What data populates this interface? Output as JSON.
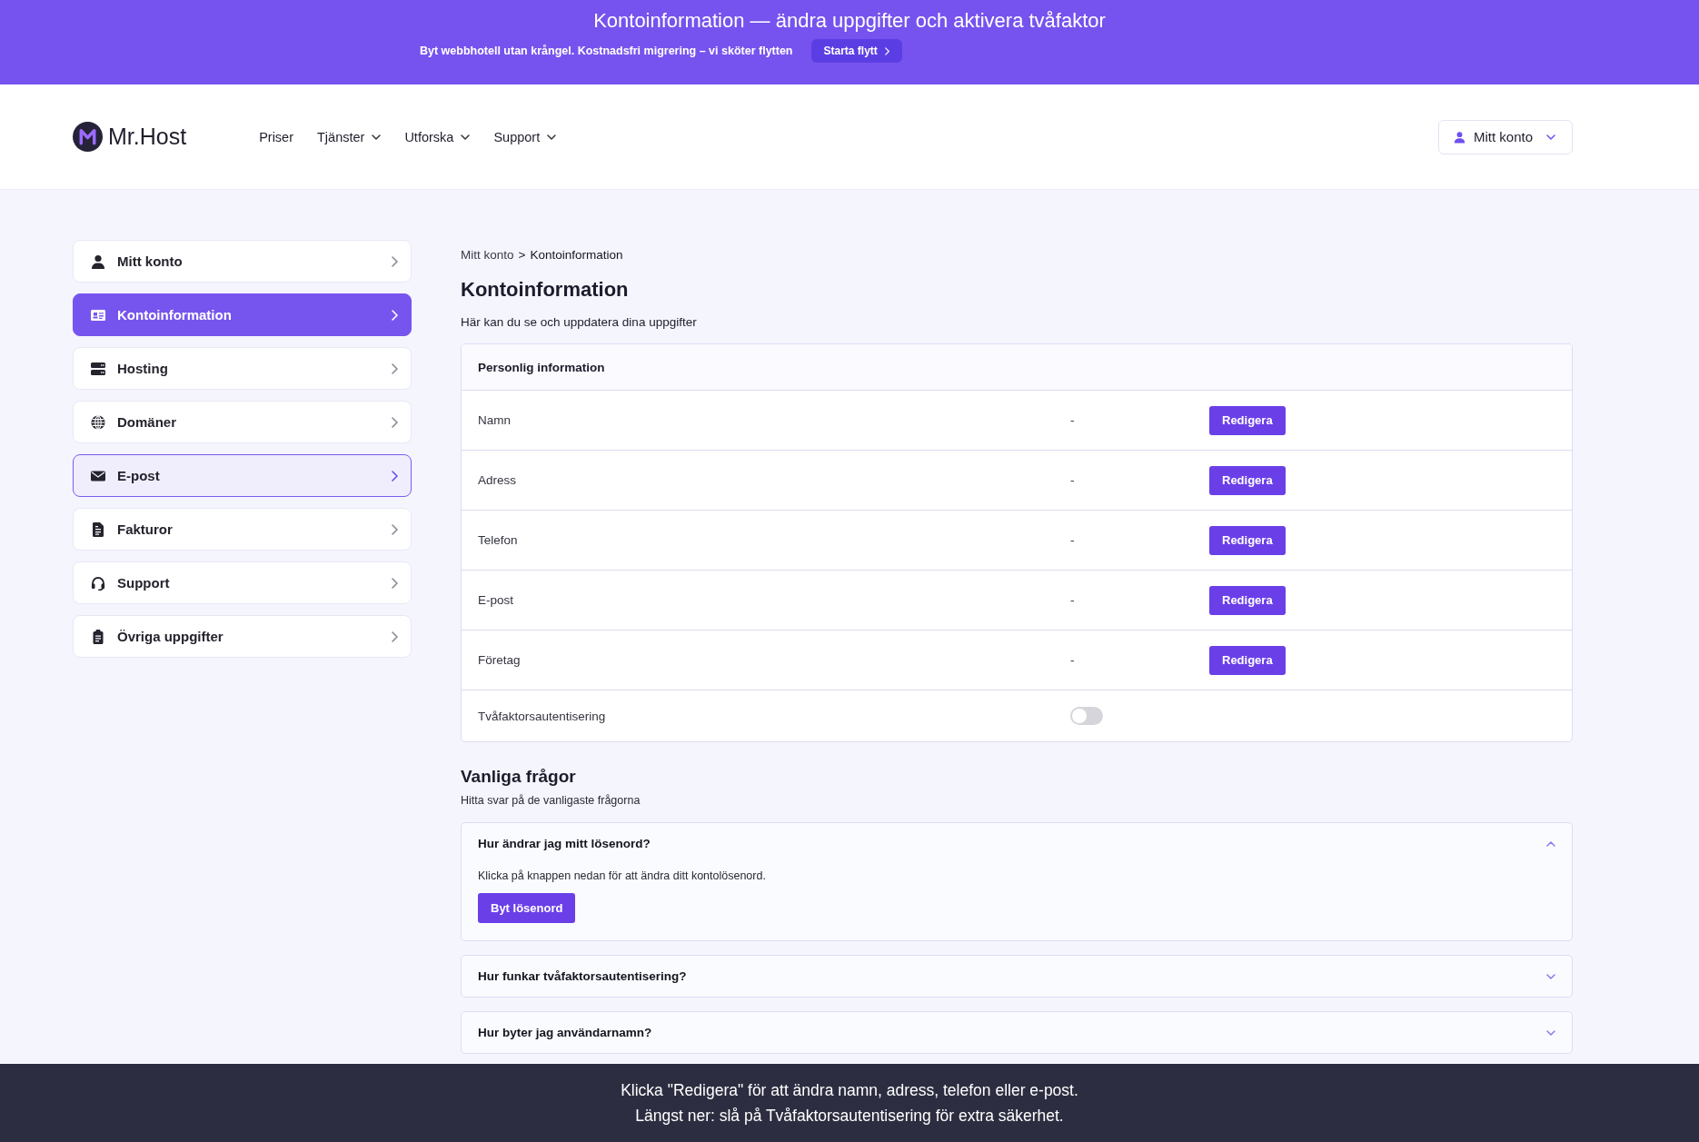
{
  "caption": {
    "title": "Kontoinformation — ändra uppgifter och aktivera tvåfaktor",
    "notes": [
      "Klicka \"Redigera\" för att ändra namn, adress, telefon eller e-post.",
      "Längst ner: slå på Tvåfaktorsautentisering för extra säkerhet."
    ]
  },
  "promo_bar": {
    "text": "Byt webbhotell utan krångel. Kostnadsfri migrering – vi sköter flytten",
    "button": "Starta flytt"
  },
  "header": {
    "logo": "Mr.Host",
    "nav": [
      {
        "label": "Priser",
        "dropdown": false
      },
      {
        "label": "Tjänster",
        "dropdown": true
      },
      {
        "label": "Utforska",
        "dropdown": true
      },
      {
        "label": "Support",
        "dropdown": true
      }
    ],
    "account_button": "Mitt konto"
  },
  "sidebar": {
    "items": [
      {
        "label": "Mitt konto",
        "selected": false,
        "hovered": false
      },
      {
        "label": "Kontoinformation",
        "selected": true,
        "hovered": false
      },
      {
        "label": "Hosting",
        "selected": false,
        "hovered": false
      },
      {
        "label": "Domäner",
        "selected": false,
        "hovered": false
      },
      {
        "label": "E-post",
        "selected": false,
        "hovered": true
      },
      {
        "label": "Fakturor",
        "selected": false,
        "hovered": false
      },
      {
        "label": "Support",
        "selected": false,
        "hovered": false
      },
      {
        "label": "Övriga uppgifter",
        "selected": false,
        "hovered": false
      }
    ]
  },
  "breadcrumb": {
    "items": [
      "Mitt konto",
      "Kontoinformation"
    ],
    "separator": ">"
  },
  "page": {
    "title": "Kontoinformation",
    "subtitle": "Här kan du se och uppdatera dina uppgifter"
  },
  "personal_info": {
    "title": "Personlig information",
    "rows": [
      {
        "kind": "field",
        "label": "Namn",
        "value": "-",
        "button": "Redigera"
      },
      {
        "kind": "field",
        "label": "Adress",
        "value": "-",
        "button": "Redigera"
      },
      {
        "kind": "field",
        "label": "Telefon",
        "value": "-",
        "button": "Redigera"
      },
      {
        "kind": "field",
        "label": "E-post",
        "value": "-",
        "button": "Redigera"
      },
      {
        "kind": "field",
        "label": "Företag",
        "value": "-",
        "button": "Redigera"
      },
      {
        "kind": "toggle",
        "label": "Tvåfaktorsautentisering",
        "on": false
      }
    ]
  },
  "faq": {
    "title": "Vanliga frågor",
    "subtitle": "Hitta svar på de vanligaste frågorna",
    "items": [
      {
        "question": "Hur ändrar jag mitt lösenord?",
        "expanded": true,
        "answer": "Klicka på knappen nedan för att ändra ditt kontolösenord.",
        "button": "Byt lösenord"
      },
      {
        "question": "Hur funkar tvåfaktorsautentisering?",
        "expanded": false
      },
      {
        "question": "Hur byter jag användarnamn?",
        "expanded": false
      }
    ]
  }
}
